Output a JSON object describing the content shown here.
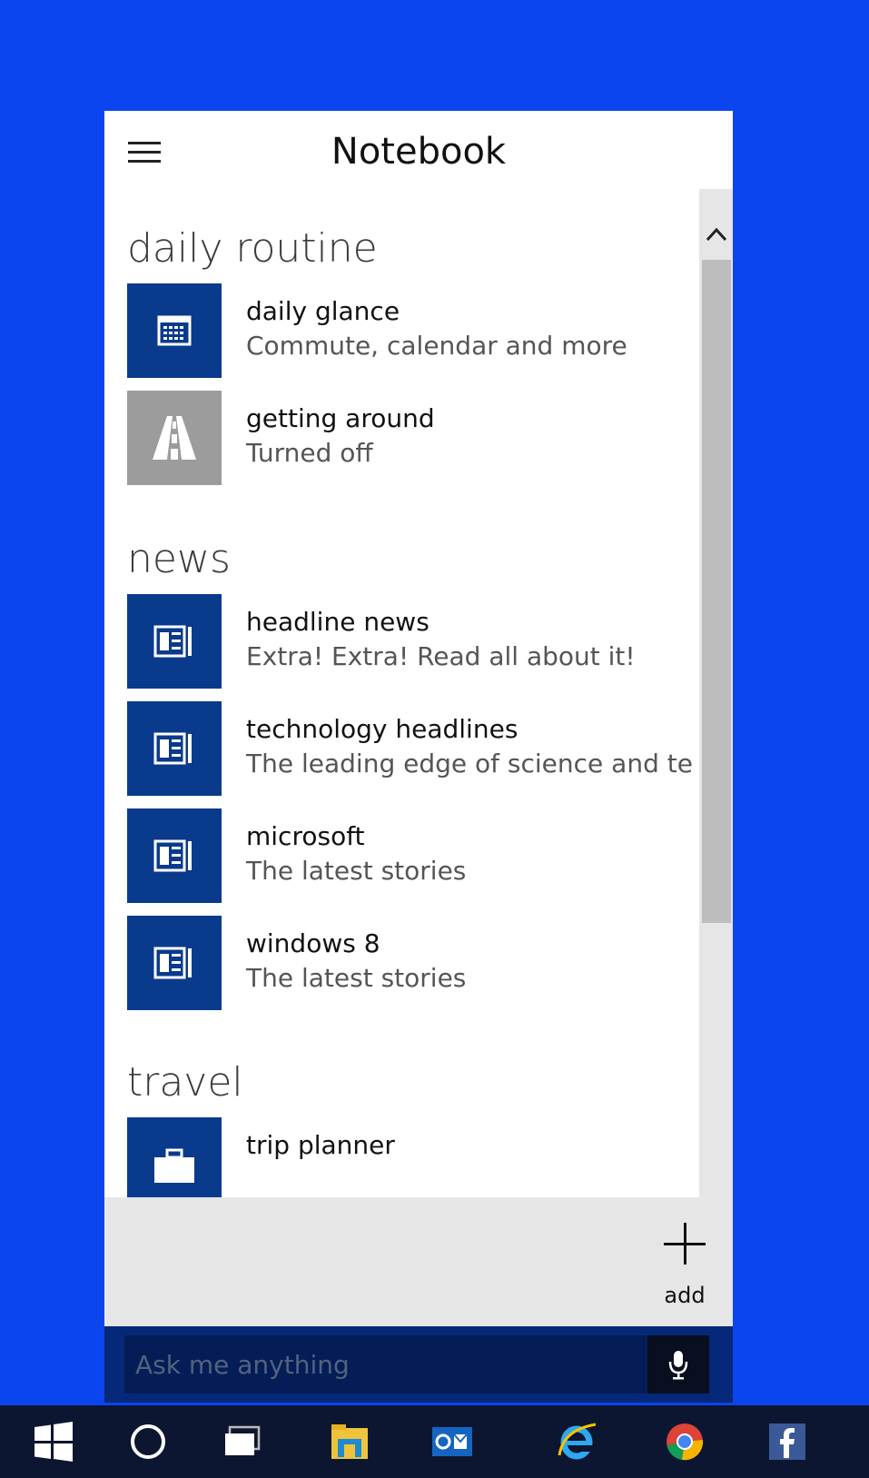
{
  "notebook": {
    "title": "Notebook",
    "sections": [
      {
        "title": "daily routine",
        "items": [
          {
            "name": "daily glance",
            "desc": "Commute, calendar and more",
            "icon": "calendar-icon"
          },
          {
            "name": "getting around",
            "desc": "Turned off",
            "icon": "road-icon"
          }
        ]
      },
      {
        "title": "news",
        "items": [
          {
            "name": "headline news",
            "desc": "Extra! Extra! Read all about it!",
            "icon": "newspaper-icon"
          },
          {
            "name": "technology headlines",
            "desc": "The leading edge of science and te",
            "icon": "newspaper-icon"
          },
          {
            "name": "microsoft",
            "desc": "The latest stories",
            "icon": "newspaper-icon"
          },
          {
            "name": "windows 8",
            "desc": "The latest stories",
            "icon": "newspaper-icon"
          }
        ]
      },
      {
        "title": "travel",
        "items": [
          {
            "name": "trip planner",
            "desc": "",
            "icon": "suitcase-icon"
          }
        ]
      }
    ],
    "add_label": "add"
  },
  "search": {
    "placeholder": "Ask me anything"
  },
  "taskbar": {
    "items": [
      "start",
      "cortana",
      "task-view",
      "file-explorer",
      "outlook",
      "internet-explorer",
      "chrome",
      "facebook"
    ]
  },
  "colors": {
    "desktop": "#0b45f0",
    "tile": "#0a3a8c",
    "tile_off": "#9c9c9c",
    "askbar": "#062878",
    "taskbar": "#0d1630"
  }
}
